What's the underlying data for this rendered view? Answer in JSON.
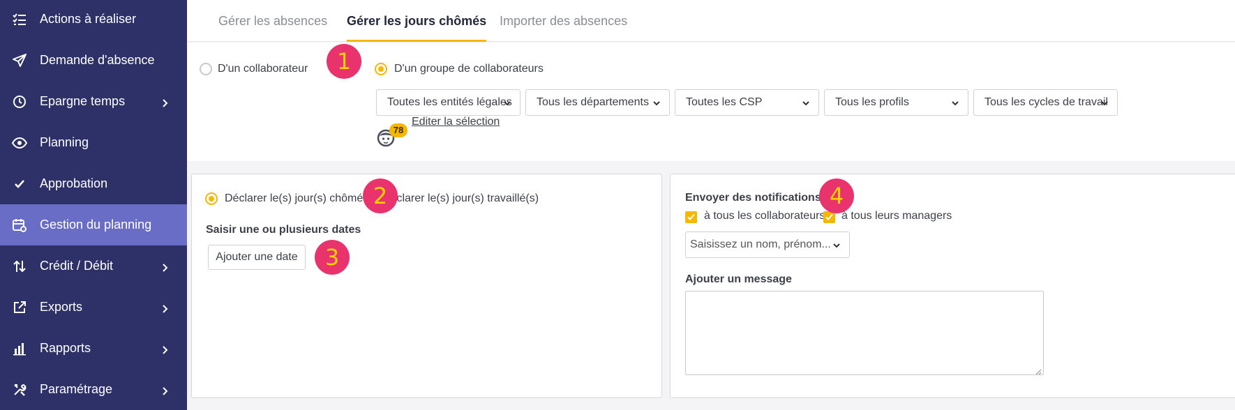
{
  "sidebar": {
    "items": [
      {
        "label": "Actions à réaliser",
        "icon": "checklist-icon",
        "chevron": false,
        "active": false
      },
      {
        "label": "Demande d'absence",
        "icon": "paper-plane-icon",
        "chevron": false,
        "active": false
      },
      {
        "label": "Epargne temps",
        "icon": "clock-icon",
        "chevron": true,
        "active": false
      },
      {
        "label": "Planning",
        "icon": "eye-icon",
        "chevron": false,
        "active": false
      },
      {
        "label": "Approbation",
        "icon": "checkmark-icon",
        "chevron": false,
        "active": false
      },
      {
        "label": "Gestion du planning",
        "icon": "calendar-gear-icon",
        "chevron": false,
        "active": true
      },
      {
        "label": "Crédit / Débit",
        "icon": "up-down-arrows-icon",
        "chevron": true,
        "active": false
      },
      {
        "label": "Exports",
        "icon": "external-link-icon",
        "chevron": true,
        "active": false
      },
      {
        "label": "Rapports",
        "icon": "bar-chart-icon",
        "chevron": true,
        "active": false
      },
      {
        "label": "Paramétrage",
        "icon": "tools-icon",
        "chevron": true,
        "active": false
      }
    ]
  },
  "tabs": [
    {
      "label": "Gérer les absences",
      "active": false
    },
    {
      "label": "Gérer les jours chômés",
      "active": true
    },
    {
      "label": "Importer des absences",
      "active": false
    }
  ],
  "target": {
    "option_single": "D'un collaborateur",
    "option_group": "D'un groupe de collaborateurs",
    "selected": "group",
    "filters": [
      "Toutes les entités légales",
      "Tous les départements",
      "Toutes les CSP",
      "Tous les profils",
      "Tous les cycles de travail"
    ],
    "count": "78",
    "edit_link": "Editer la sélection"
  },
  "left_card": {
    "option_off": "Déclarer le(s) jour(s) chômé(s)",
    "option_on": "Déclarer le(s) jour(s) travaillé(s)",
    "selected": "off",
    "dates_label": "Saisir une ou plusieurs dates",
    "add_date_button": "Ajouter une date"
  },
  "right_card": {
    "notifications_label": "Envoyer des notifications",
    "check_all_employees": "à tous les collaborateurs",
    "check_all_managers": "à tous leurs managers",
    "employees_checked": true,
    "managers_checked": true,
    "recipient_placeholder": "Saisissez un nom, prénom...",
    "message_label": "Ajouter un message",
    "message_value": ""
  },
  "markers": [
    "1",
    "2",
    "3",
    "4"
  ],
  "colors": {
    "sidebar_bg": "#2e3168",
    "sidebar_active": "#6a6dc6",
    "accent": "#f5b700",
    "marker_bg": "#e8336d",
    "marker_text": "#ffd400"
  }
}
